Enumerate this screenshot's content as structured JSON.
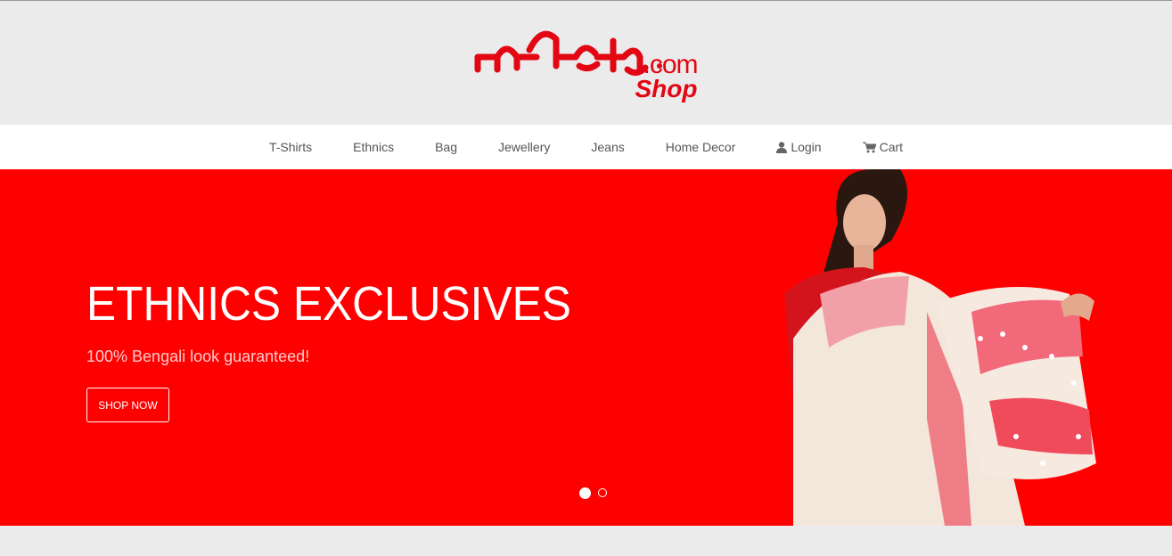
{
  "brand": {
    "logo_text": "পশ্চিমবাঙালি",
    "logo_com": ".com",
    "logo_shop": "Shop",
    "accent": "#e30613"
  },
  "nav": {
    "items": [
      {
        "label": "T-Shirts"
      },
      {
        "label": "Ethnics"
      },
      {
        "label": "Bag"
      },
      {
        "label": "Jewellery"
      },
      {
        "label": "Jeans"
      },
      {
        "label": "Home Decor"
      },
      {
        "label": "Login",
        "icon": "user-icon"
      },
      {
        "label": "Cart",
        "icon": "cart-icon"
      }
    ]
  },
  "hero": {
    "title": "ETHNICS EXCLUSIVES",
    "subtitle": "100% Bengali look guaranteed!",
    "button": "SHOP NOW",
    "background": "#ff0000",
    "slides_total": 2,
    "active_slide": 1
  }
}
